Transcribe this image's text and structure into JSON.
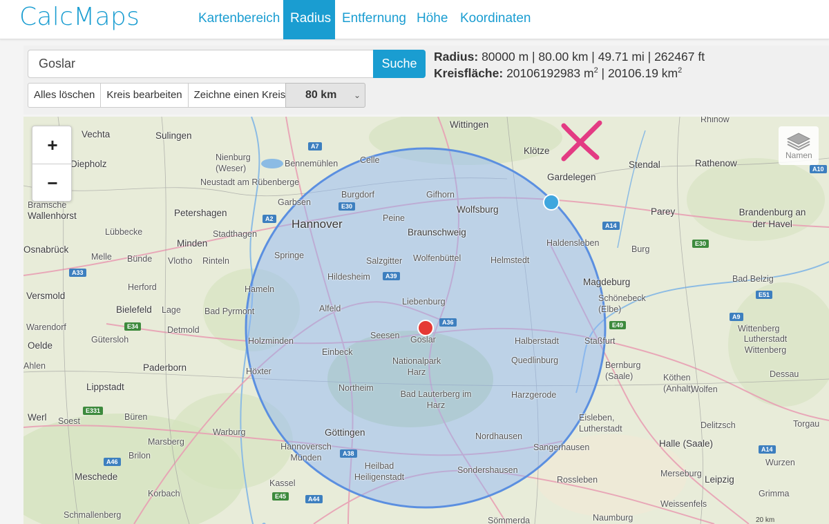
{
  "app": {
    "brand": "CalcMaps"
  },
  "nav": {
    "items": [
      {
        "label": "Kartenbereich",
        "active": false
      },
      {
        "label": "Radius",
        "active": true
      },
      {
        "label": "Entfernung",
        "active": false
      },
      {
        "label": "Höhe",
        "active": false
      },
      {
        "label": "Koordinaten",
        "active": false
      }
    ]
  },
  "search": {
    "value": "Goslar",
    "button_label": "Suche"
  },
  "info": {
    "radius_label": "Radius:",
    "radius_value": "80000 m | 80.00 km | 49.71 mi | 262467 ft",
    "area_label": "Kreisfläche:",
    "area_m2": "20106192983 m",
    "area_sep": " | 20106.19 km",
    "sup": "2"
  },
  "toolbar": {
    "clear_label": "Alles löschen",
    "edit_label": "Kreis bearbeiten",
    "draw_label": "Zeichne einen Kreis",
    "radius_select": "80 km"
  },
  "map": {
    "zoom_in": "+",
    "zoom_out": "−",
    "layers_label": "Namen",
    "attribution": "20 km",
    "colors": {
      "circle_fill": "#8ab4f8",
      "circle_stroke": "#5b8fe0",
      "center_marker": "#e53935",
      "edge_marker": "#3fa6de",
      "cross": "#e33b83"
    },
    "cities": [
      "Vechta",
      "Sulingen",
      "Wittingen",
      "Klötze",
      "Diepholz",
      "Nienburg (Weser)",
      "Bennemühlen",
      "Celle",
      "Neustadt am Rübenberge",
      "Gardelegen",
      "Stendal",
      "Rathenow",
      "Rhinow",
      "Bramsche",
      "Wallenhorst",
      "Petershagen",
      "Garbsen",
      "Burgdorf",
      "Gifhorn",
      "Wolfsburg",
      "Parey",
      "Brandenburg an der Havel",
      "Lübbecke",
      "Minden",
      "Stadthagen",
      "Hannover",
      "Peine",
      "Braunschweig",
      "Haldensleben",
      "Burg",
      "Osnabrück",
      "Melle",
      "Bünde",
      "Vlotho",
      "Rinteln",
      "Springe",
      "Salzgitter",
      "Wolfenbüttel",
      "Helmstedt",
      "Herford",
      "Hameln",
      "Hildesheim",
      "Magdeburg",
      "Bad Belzig",
      "Versmold",
      "Bielefeld",
      "Lage",
      "Bad Pyrmont",
      "Alfeld",
      "Liebenburg",
      "Schönebeck (Elbe)",
      "Detmold",
      "Warendorf",
      "Gütersloh",
      "Holzminden",
      "Seesen",
      "Goslar",
      "Halberstadt",
      "Staßfurt",
      "Wittenberg",
      "Oelde",
      "Einbeck",
      "Nationalpark Harz",
      "Quedlinburg",
      "Lutherstadt Wittenberg",
      "Ahlen",
      "Bernburg (Saale)",
      "Köthen (Anhalt)",
      "Dessau",
      "Lippstadt",
      "Paderborn",
      "Höxter",
      "Northeim",
      "Bad Lauterberg im Harz",
      "Harzgerode",
      "Wolfen",
      "Werl",
      "Soest",
      "Büren",
      "Eisleben, Lutherstadt",
      "Delitzsch",
      "Torgau",
      "Marsberg",
      "Warburg",
      "Göttingen",
      "Nordhausen",
      "Halle (Saale)",
      "Hannoversch Münden",
      "Sangerhausen",
      "Brilon",
      "Meschede",
      "Kassel",
      "Heilbad Heiligenstadt",
      "Sondershausen",
      "Merseburg",
      "Leipzig",
      "Wurzen",
      "Rossleben",
      "Korbach",
      "Grimma",
      "Schmallenberg",
      "Weissenfels",
      "Naumburg",
      "Sömmerda"
    ]
  }
}
